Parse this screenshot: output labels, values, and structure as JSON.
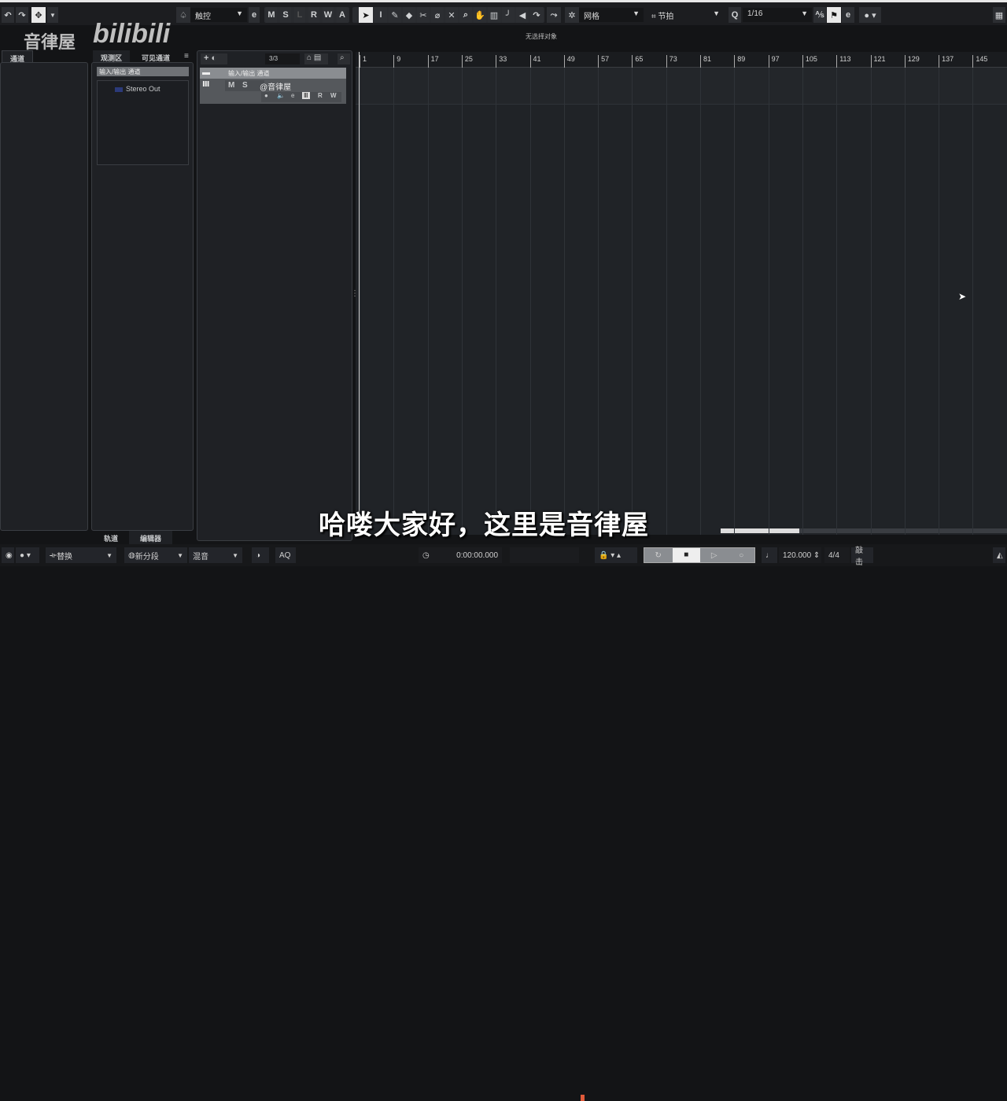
{
  "toolbar": {
    "automation_mode": "触控",
    "msl": [
      "M",
      "S",
      "L",
      "R",
      "W",
      "A"
    ],
    "snap_type": "网格",
    "grid_type": "节拍",
    "quantize": "1/16"
  },
  "watermark": {
    "channel": "音律屋",
    "logo": "bilibili"
  },
  "info_line": "无选择对象",
  "left_zone": {
    "tab": "通道"
  },
  "inspector": {
    "tabs": [
      "观测区",
      "可见通道"
    ],
    "folder": "输入/输出 通道",
    "item": "Stereo Out",
    "bottom_tabs": [
      "轨道",
      "编辑器"
    ]
  },
  "track_list": {
    "count": "3/3",
    "folder_track": "输入/输出 通道",
    "track_name": "@音律屋",
    "track_buttons": [
      "M",
      "S"
    ],
    "track_ctrl": [
      "●",
      "🔈",
      "e",
      "Ⅲ",
      "R",
      "W"
    ]
  },
  "ruler": {
    "bars": [
      "1",
      "9",
      "17",
      "25",
      "33",
      "41",
      "49",
      "57",
      "65",
      "73",
      "81",
      "89",
      "97",
      "105",
      "113",
      "121",
      "129",
      "137",
      "145"
    ]
  },
  "transport": {
    "record_mode": "替换",
    "cycle_mode": "新分段",
    "mix_mode": "混音",
    "aq": "AQ",
    "time": "0:00:00.000",
    "tempo": "120.000",
    "signature": "4/4",
    "click": "敲击"
  },
  "subtitle": "哈喽大家好，这里是音律屋"
}
